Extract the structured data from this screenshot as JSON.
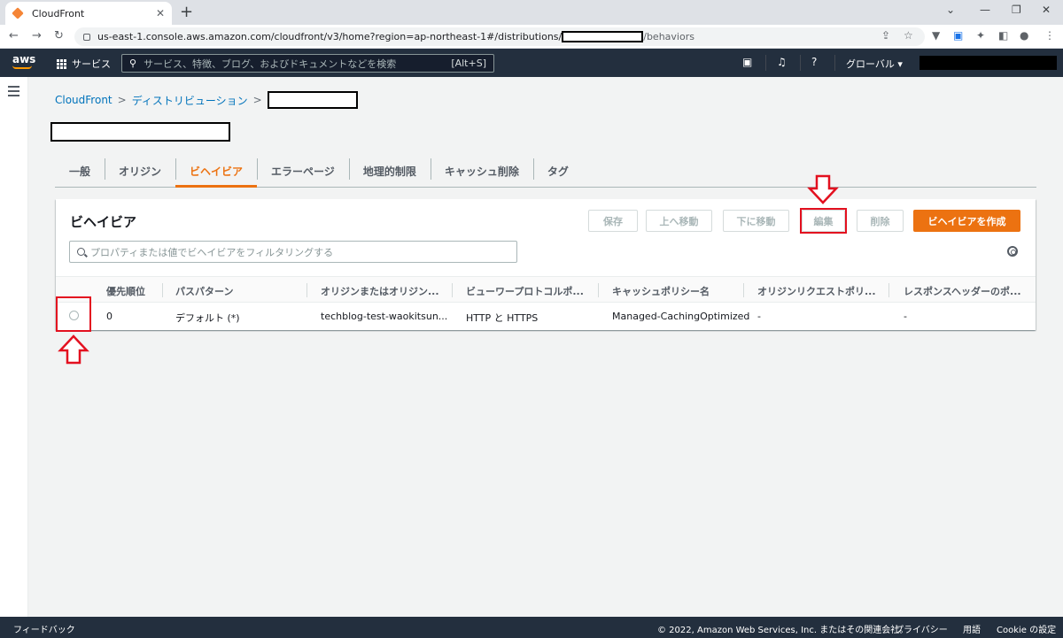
{
  "browser": {
    "tab_title": "CloudFront",
    "tab_close": "✕",
    "new_tab": "+",
    "url_prefix": "us-east-1.console.aws.amazon.com/cloudfront/v3/home?region=ap-northeast-1#/distributions/",
    "url_suffix": "/behaviors"
  },
  "aws_nav": {
    "logo": "aws",
    "services_label": "サービス",
    "search_placeholder": "サービス、特徴、ブログ、およびドキュメントなどを検索",
    "search_shortcut": "[Alt+S]",
    "region_label": "グローバル ▾"
  },
  "breadcrumb": {
    "root": "CloudFront",
    "distributions": "ディストリビューション",
    "separator": ">"
  },
  "tabs": [
    {
      "label": "一般",
      "active": false
    },
    {
      "label": "オリジン",
      "active": false
    },
    {
      "label": "ビヘイビア",
      "active": true
    },
    {
      "label": "エラーページ",
      "active": false
    },
    {
      "label": "地理的制限",
      "active": false
    },
    {
      "label": "キャッシュ削除",
      "active": false
    },
    {
      "label": "タグ",
      "active": false
    }
  ],
  "panel": {
    "title": "ビヘイビア",
    "buttons": {
      "save": "保存",
      "move_up": "上へ移動",
      "move_down": "下に移動",
      "edit": "編集",
      "delete": "削除",
      "create": "ビヘイビアを作成"
    },
    "filter_placeholder": "プロパティまたは値でビヘイビアをフィルタリングする"
  },
  "table": {
    "columns": [
      "優先順位",
      "パスパターン",
      "オリジンまたはオリジン...",
      "ビューワープロトコルポ...",
      "キャッシュポリシー名",
      "オリジンリクエストポリ...",
      "レスポンスヘッダーのポ..."
    ],
    "rows": [
      {
        "priority": "0",
        "path": "デフォルト (*)",
        "origin": "techblog-test-waokitsun...",
        "viewer_protocol": "HTTP と HTTPS",
        "cache_policy": "Managed-CachingOptimized",
        "origin_request_policy": "-",
        "response_headers_policy": "-"
      }
    ]
  },
  "footer": {
    "feedback": "フィードバック",
    "copyright": "© 2022, Amazon Web Services, Inc. またはその関連会社。",
    "privacy": "プライバシー",
    "terms": "用語",
    "cookie": "Cookie の設定"
  },
  "colors": {
    "accent": "#ec7211",
    "link": "#0073bb",
    "nav_bg": "#232f3e",
    "annotation_red": "#e3101f"
  }
}
